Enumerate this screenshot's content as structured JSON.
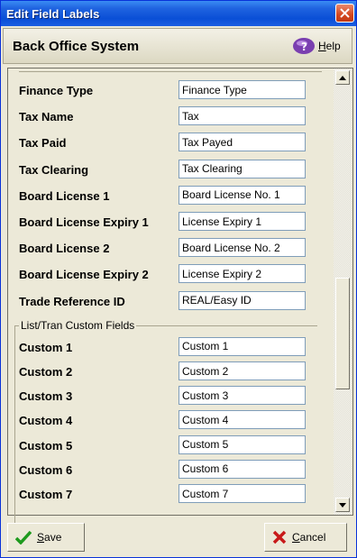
{
  "window": {
    "title": "Edit Field Labels"
  },
  "header": {
    "app_title": "Back Office System",
    "help_label": "Help"
  },
  "fields": [
    {
      "label": "Finance Type",
      "value": "Finance Type"
    },
    {
      "label": "Tax Name",
      "value": "Tax"
    },
    {
      "label": "Tax Paid",
      "value": "Tax Payed"
    },
    {
      "label": "Tax Clearing",
      "value": "Tax Clearing"
    },
    {
      "label": "Board License 1",
      "value": "Board License No. 1"
    },
    {
      "label": "Board License Expiry 1",
      "value": "License Expiry 1"
    },
    {
      "label": "Board License 2",
      "value": "Board License No. 2"
    },
    {
      "label": "Board License Expiry 2",
      "value": "License Expiry 2"
    },
    {
      "label": "Trade Reference ID",
      "value": "REAL/Easy ID"
    }
  ],
  "custom_group": {
    "title": "List/Tran Custom Fields",
    "fields": [
      {
        "label": "Custom 1",
        "value": "Custom 1"
      },
      {
        "label": "Custom 2",
        "value": "Custom 2"
      },
      {
        "label": "Custom 3",
        "value": "Custom 3"
      },
      {
        "label": "Custom 4",
        "value": "Custom 4"
      },
      {
        "label": "Custom 5",
        "value": "Custom 5"
      },
      {
        "label": "Custom 6",
        "value": "Custom 6"
      },
      {
        "label": "Custom 7",
        "value": "Custom 7"
      }
    ]
  },
  "footer": {
    "save_label": "Save",
    "cancel_label": "Cancel"
  },
  "colors": {
    "title_bar": "#0a4fd6",
    "close_button": "#d4471f",
    "save_icon": "#1e9a1e",
    "cancel_icon": "#c81a1a"
  }
}
